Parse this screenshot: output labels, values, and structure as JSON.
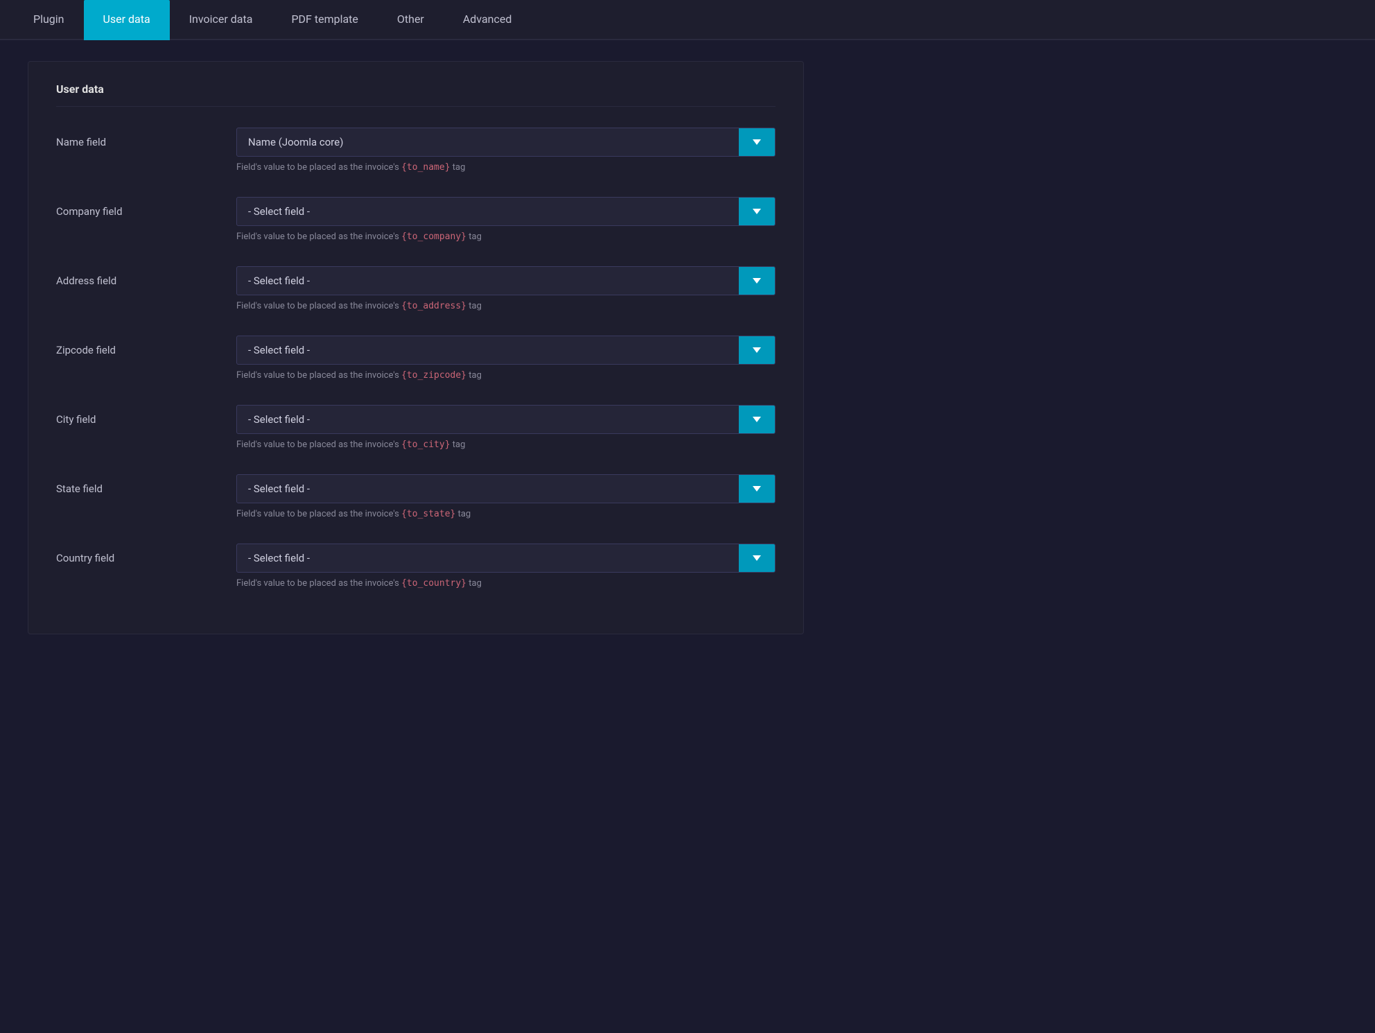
{
  "tabs": [
    {
      "id": "plugin",
      "label": "Plugin",
      "active": false
    },
    {
      "id": "user-data",
      "label": "User data",
      "active": true
    },
    {
      "id": "invoicer-data",
      "label": "Invoicer data",
      "active": false
    },
    {
      "id": "pdf-template",
      "label": "PDF template",
      "active": false
    },
    {
      "id": "other",
      "label": "Other",
      "active": false
    },
    {
      "id": "advanced",
      "label": "Advanced",
      "active": false
    }
  ],
  "section": {
    "title": "User data"
  },
  "fields": [
    {
      "label": "Name field",
      "value": "Name (Joomla core)",
      "hint_prefix": "Field's value to be placed as the invoice's ",
      "hint_tag": "{to_name}",
      "hint_suffix": " tag"
    },
    {
      "label": "Company field",
      "value": "- Select field -",
      "hint_prefix": "Field's value to be placed as the invoice's ",
      "hint_tag": "{to_company}",
      "hint_suffix": " tag"
    },
    {
      "label": "Address field",
      "value": "- Select field -",
      "hint_prefix": "Field's value to be placed as the invoice's ",
      "hint_tag": "{to_address}",
      "hint_suffix": " tag"
    },
    {
      "label": "Zipcode field",
      "value": "- Select field -",
      "hint_prefix": "Field's value to be placed as the invoice's ",
      "hint_tag": "{to_zipcode}",
      "hint_suffix": " tag"
    },
    {
      "label": "City field",
      "value": "- Select field -",
      "hint_prefix": "Field's value to be placed as the invoice's ",
      "hint_tag": "{to_city}",
      "hint_suffix": " tag"
    },
    {
      "label": "State field",
      "value": "- Select field -",
      "hint_prefix": "Field's value to be placed as the invoice's ",
      "hint_tag": "{to_state}",
      "hint_suffix": " tag"
    },
    {
      "label": "Country field",
      "value": "- Select field -",
      "hint_prefix": "Field's value to be placed as the invoice's ",
      "hint_tag": "{to_country}",
      "hint_suffix": " tag"
    }
  ],
  "colors": {
    "active_tab_bg": "#0099bb",
    "select_btn_bg": "#0099bb",
    "tag_color": "#cc6677"
  }
}
